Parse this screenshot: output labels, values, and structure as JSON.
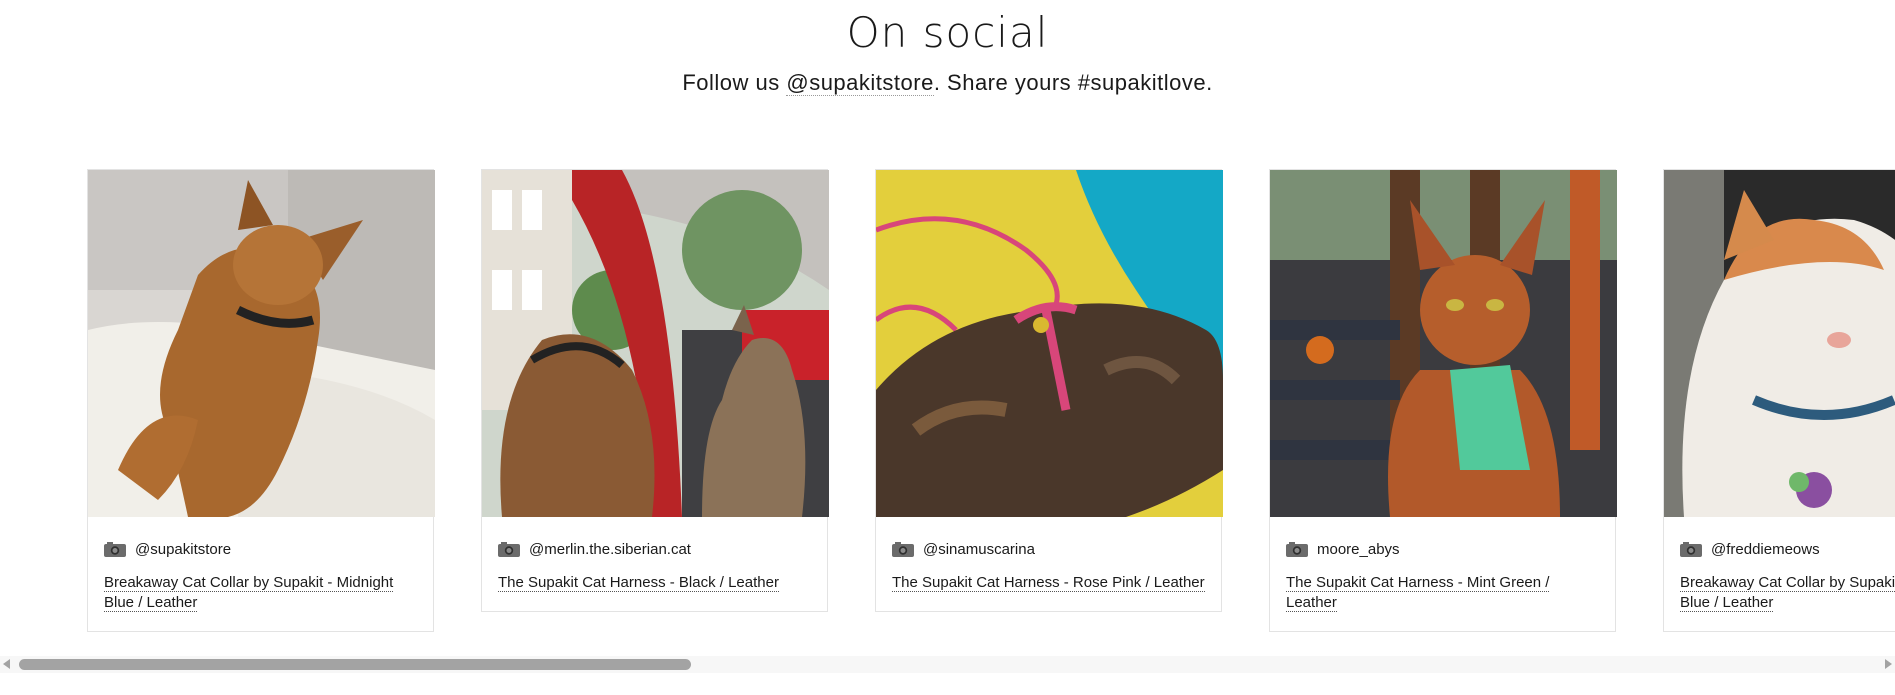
{
  "section": {
    "title": "On social",
    "subtitle_prefix": "Follow us ",
    "subtitle_handle": "@supakitstore",
    "subtitle_suffix": ". Share yours #supakitlove."
  },
  "posts": [
    {
      "username": "@supakitstore",
      "product": "Breakaway Cat Collar by Supakit - Midnight Blue / Leather",
      "icon": "camera-icon",
      "photo": "abyssinian-cat-collar-looking-up"
    },
    {
      "username": "@merlin.the.siberian.cat",
      "product": "The Supakit Cat Harness - Black / Leather",
      "icon": "camera-icon",
      "photo": "two-cats-in-car-window"
    },
    {
      "username": "@sinamuscarina",
      "product": "The Supakit Cat Harness - Rose Pink / Leather",
      "icon": "camera-icon",
      "photo": "tortoiseshell-cat-pink-harness"
    },
    {
      "username": "moore_abys",
      "product": "The Supakit Cat Harness - Mint Green / Leather",
      "icon": "camera-icon",
      "photo": "abyssinian-cat-mint-harness-porch"
    },
    {
      "username": "@freddiemeows",
      "product": "Breakaway Cat Collar by Supakit - Midnight Blue / Leather",
      "icon": "camera-icon",
      "photo": "orange-white-cat-blue-collar"
    }
  ],
  "colors": {
    "text": "#1a1a1a",
    "border": "#e3e3e3",
    "scroll_thumb": "#a3a3a3"
  },
  "scrollbar": {
    "visible_fraction": 0.36
  }
}
